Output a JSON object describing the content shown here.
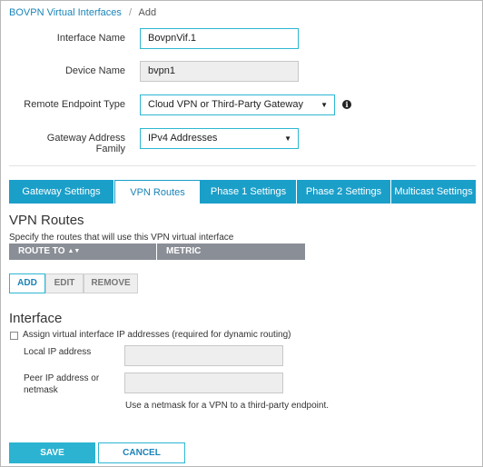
{
  "breadcrumb": {
    "link": "BOVPN Virtual Interfaces",
    "separator": "/",
    "current": "Add"
  },
  "form": {
    "interface_name": {
      "label": "Interface Name",
      "value": "BovpnVif.1"
    },
    "device_name": {
      "label": "Device Name",
      "value": "bvpn1"
    },
    "remote_endpoint_type": {
      "label": "Remote Endpoint Type",
      "value": "Cloud VPN or Third-Party Gateway"
    },
    "gateway_address_family": {
      "label": "Gateway Address Family",
      "value": "IPv4 Addresses"
    }
  },
  "tabs": [
    {
      "label": "Gateway Settings",
      "active": false
    },
    {
      "label": "VPN Routes",
      "active": true
    },
    {
      "label": "Phase 1 Settings",
      "active": false
    },
    {
      "label": "Phase 2 Settings",
      "active": false
    },
    {
      "label": "Multicast Settings",
      "active": false
    }
  ],
  "vpn_routes": {
    "title": "VPN Routes",
    "description": "Specify the routes that will use this VPN virtual interface",
    "columns": [
      "ROUTE TO",
      "METRIC"
    ],
    "buttons": {
      "add": "ADD",
      "edit": "EDIT",
      "remove": "REMOVE"
    }
  },
  "interface": {
    "title": "Interface",
    "checkbox_label": "Assign virtual interface IP addresses (required for dynamic routing)",
    "checked": false,
    "local_ip_label": "Local IP address",
    "peer_ip_label_line1": "Peer IP address or",
    "peer_ip_label_line2": "netmask",
    "help": "Use a netmask for a VPN to a third-party endpoint."
  },
  "footer": {
    "save": "SAVE",
    "cancel": "CANCEL"
  },
  "colors": {
    "accent": "#1a9fc9",
    "link": "#1a84b8",
    "header_gray": "#8a8e96"
  },
  "icons": {
    "info": "info-icon",
    "caret": "chevron-down-icon",
    "sort": "sort-icon"
  }
}
